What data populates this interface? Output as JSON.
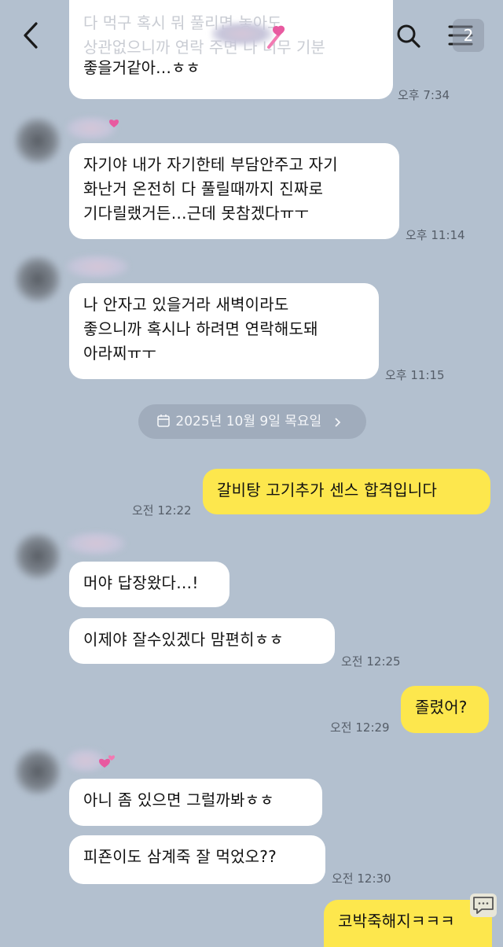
{
  "colors": {
    "background": "#b3c0cf",
    "my_bubble": "#fde74d",
    "their_bubble": "#ffffff"
  },
  "header": {
    "menu_badge": "2",
    "icons": [
      "back-arrow-icon",
      "search-icon",
      "menu-icon"
    ]
  },
  "top_message": {
    "line1": "다 먹구 혹시 뭐 풀리면 놓아도",
    "line2": "상관없으니까 연락 주면 나 너무 기분",
    "line3": "좋을거같아…ㅎㅎ",
    "time": "오후 7:34"
  },
  "messages": [
    {
      "text_lines": [
        "자기야 내가 자기한테 부담안주고 자기",
        "화난거 온전히 다 풀릴때까지 진짜로",
        "기다릴랬거든…근데 못참겠다ㅠㅜ"
      ],
      "time": "오후 11:14"
    },
    {
      "text_lines": [
        "나 안자고 있을거라 새벽이라도",
        "좋으니까 혹시나 하려면 연락해도돼",
        "아라찌ㅠㅜ"
      ],
      "time": "오후 11:15"
    },
    {
      "text": "갈비탕 고기추가 센스 합격입니다",
      "time": "오전 12:22"
    },
    {
      "text": "머야 답장왔다…!"
    },
    {
      "text": "이제야 잘수있겠다 맘편히ㅎㅎ",
      "time": "오전 12:25"
    },
    {
      "text": "졸렸어?",
      "time": "오전 12:29"
    },
    {
      "text": "아니 좀 있으면 그럴까봐ㅎㅎ"
    },
    {
      "text": "피죤이도 삼계죽 잘 먹었오??",
      "time": "오전 12:30"
    },
    {
      "text": "코박죽해지ㅋㅋㅋ"
    }
  ],
  "date_divider": "2025년 10월 9일 목요일"
}
